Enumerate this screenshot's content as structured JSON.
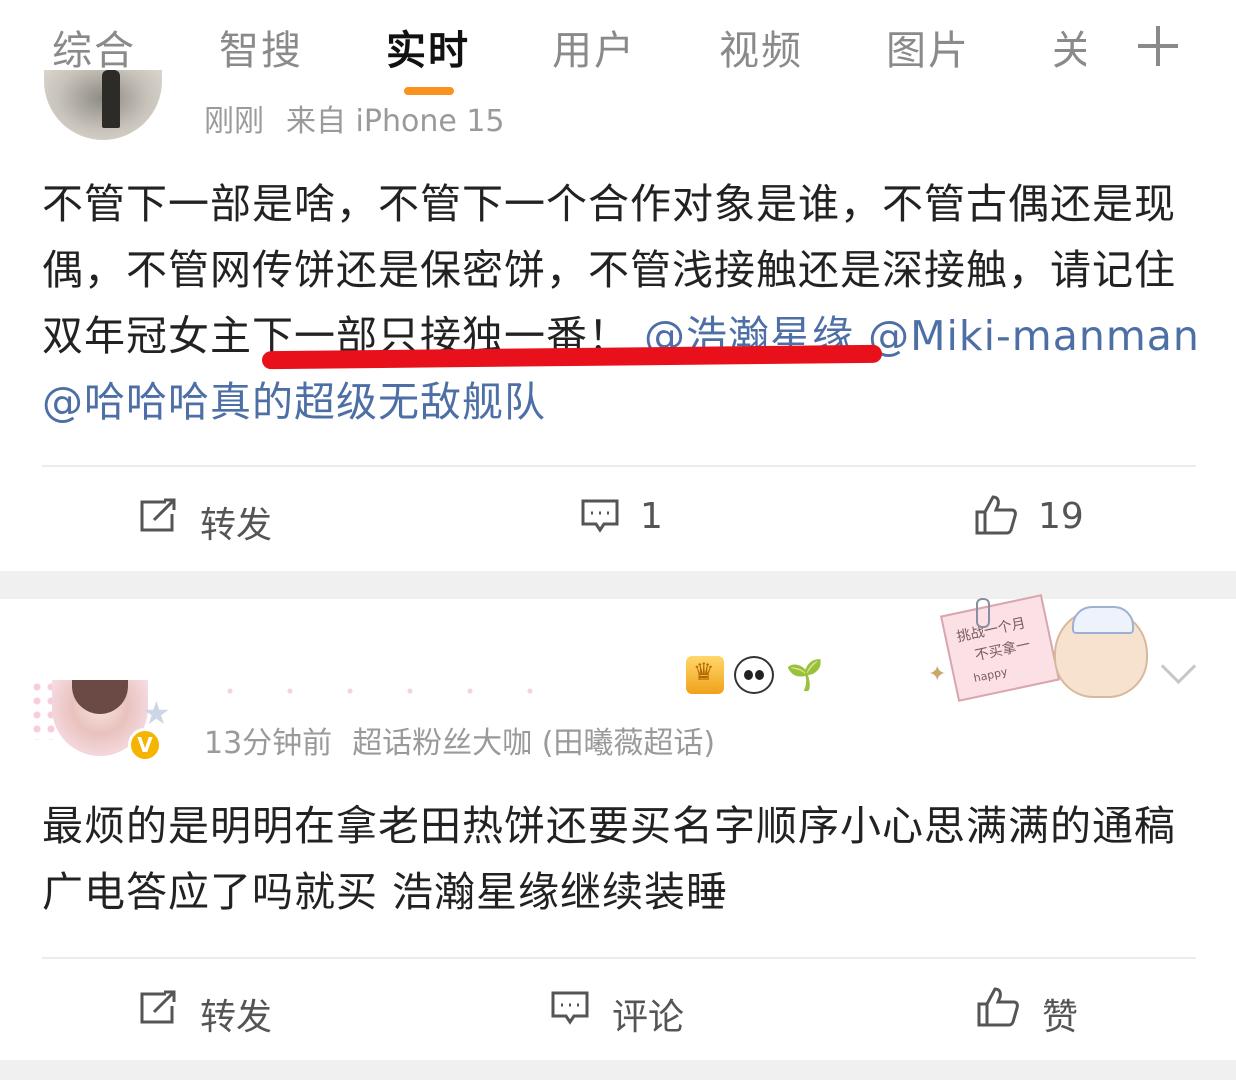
{
  "tabs": [
    {
      "label": "综合",
      "active": false
    },
    {
      "label": "智搜",
      "active": false
    },
    {
      "label": "实时",
      "active": true
    },
    {
      "label": "用户",
      "active": false
    },
    {
      "label": "视频",
      "active": false
    },
    {
      "label": "图片",
      "active": false
    },
    {
      "label": "关",
      "active": false
    }
  ],
  "accent_color": "#f7931e",
  "mention_color": "#4d6fa6",
  "underline_color": "#e8101a",
  "post1": {
    "time": "刚刚",
    "source": "来自 iPhone 15",
    "text_plain": "不管下一部是啥，不管下一个合作对象是谁，不管古偶还是现偶，不管网传饼还是保密饼，不管浅接触还是深接触，请记住双年冠女主下一部只接独一番！",
    "mentions": [
      "@浩瀚星缘",
      "@Miki-manman",
      "@哈哈哈真的超级无敌舰队"
    ],
    "actions": {
      "share": "转发",
      "comments": "1",
      "likes": "19"
    }
  },
  "post2": {
    "time": "13分钟前",
    "source": "超话粉丝大咖 (田曦薇超话)",
    "text": "最烦的是明明在拿老田热饼还要买名字顺序小心思满满的通稿 广电答应了吗就买 浩瀚星缘继续装睡",
    "actions": {
      "share": "转发",
      "comment": "评论",
      "like": "赞"
    }
  },
  "decor": {
    "note_text_1": "挑战一个月",
    "note_text_2": "不买拿一",
    "note_text_3": "happy",
    "verified_mark": "V"
  }
}
